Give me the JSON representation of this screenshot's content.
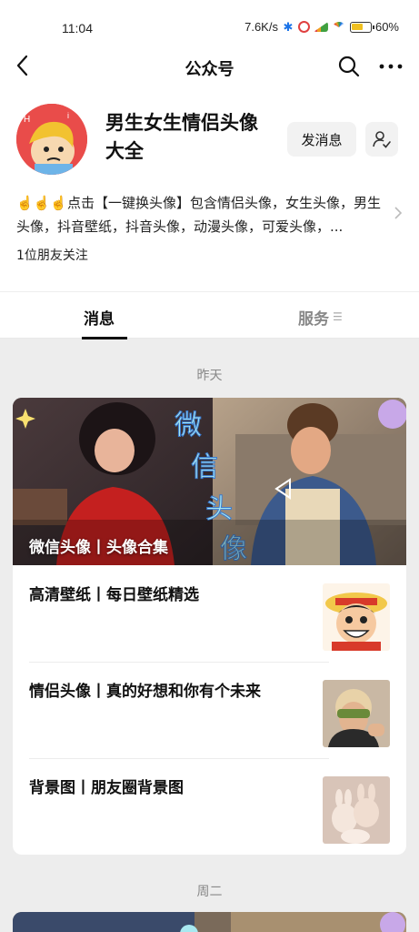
{
  "status_bar": {
    "time": "11:04",
    "network_speed": "7.6K/s",
    "battery": "60%"
  },
  "nav": {
    "title": "公众号"
  },
  "profile": {
    "name": "男生女生情侣头像大全",
    "send_message_label": "发消息",
    "description": "☝️☝️☝️点击【一键换头像】包含情侣头像，女生头像，男生头像，抖音壁纸，抖音头像，动漫头像，可爱头像，...",
    "friends_following": "1位朋友关注"
  },
  "tabs": [
    {
      "label": "消息",
      "active": true
    },
    {
      "label": "服务",
      "active": false
    }
  ],
  "feed": [
    {
      "date": "昨天",
      "cover_caption": "微信头像丨头像合集",
      "cover_overlay_text": [
        "微",
        "信",
        "头",
        "像"
      ],
      "items": [
        {
          "title": "高清壁纸丨每日壁纸精选",
          "thumb": "anime-boy-straw-hat-thumbnail"
        },
        {
          "title": "情侣头像丨真的好想和你有个未来",
          "thumb": "person-sunglasses-thumbnail"
        },
        {
          "title": "背景图丨朋友圈背景图",
          "thumb": "plush-bunnies-thumbnail"
        }
      ]
    },
    {
      "date": "周二"
    }
  ],
  "colors": {
    "accent_dark": "#111111",
    "page_bg": "#ededed",
    "avatar_bg": "#e94c4a"
  }
}
